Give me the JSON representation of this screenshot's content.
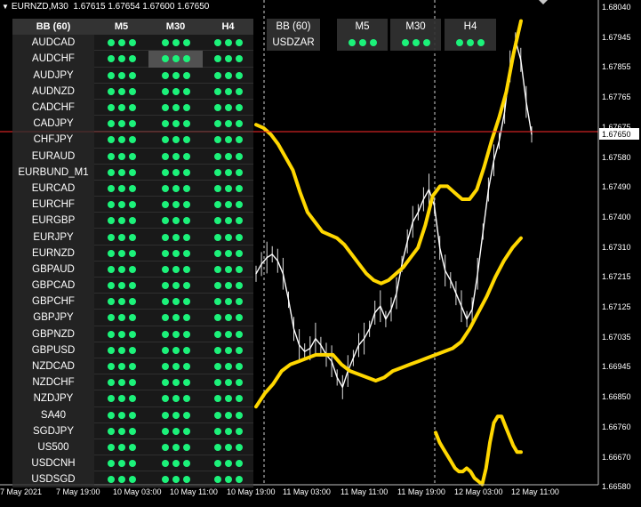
{
  "header": {
    "symbol_label": "EURNZD,M30",
    "ohlc": "1.67615 1.67654 1.67600 1.67650"
  },
  "dashboard": {
    "title": "BB (60)",
    "columns": [
      "M5",
      "M30",
      "H4"
    ],
    "rows": [
      "AUDCAD",
      "AUDCHF",
      "AUDJPY",
      "AUDNZD",
      "CADCHF",
      "CADJPY",
      "CHFJPY",
      "EURAUD",
      "EURBUND_M1",
      "EURCAD",
      "EURCHF",
      "EURGBP",
      "EURJPY",
      "EURNZD",
      "GBPAUD",
      "GBPCAD",
      "GBPCHF",
      "GBPJPY",
      "GBPNZD",
      "GBPUSD",
      "NZDCAD",
      "NZDCHF",
      "NZDJPY",
      "SA40",
      "SGDJPY",
      "US500",
      "USDCNH",
      "USDSGD"
    ],
    "signal_color": "#1cf27a",
    "highlight_cell": {
      "row": 1,
      "col": 1
    }
  },
  "dashboard2": {
    "title": "BB (60)",
    "columns": [
      "M5",
      "M30",
      "H4"
    ],
    "rows": [
      "USDZAR"
    ]
  },
  "price_axis": {
    "ticks": [
      "1.68040",
      "1.67945",
      "1.67855",
      "1.67765",
      "1.67675",
      "1.67580",
      "1.67490",
      "1.67400",
      "1.67310",
      "1.67215",
      "1.67125",
      "1.67035",
      "1.66945",
      "1.66850",
      "1.66760",
      "1.66670",
      "1.66580"
    ],
    "current_price": "1.67650"
  },
  "time_axis": {
    "labels": [
      "7 May 2021",
      "7 May 19:00",
      "10 May 03:00",
      "10 May 11:00",
      "10 May 19:00",
      "11 May 03:00",
      "11 May 11:00",
      "11 May 19:00",
      "12 May 03:00",
      "12 May 11:00"
    ]
  },
  "colors": {
    "bands": "#ffd700",
    "price_line": "#ffffff",
    "current_price_line": "#ff2a2a",
    "grid": "#cfcfcf"
  },
  "chart_data": {
    "type": "line",
    "title": "",
    "y_range": [
      1.6658,
      1.6804
    ],
    "series": [
      {
        "values": [
          1.6722,
          1.6725,
          1.6727,
          1.6728,
          1.6726,
          1.6722,
          1.6714,
          1.6705,
          1.67,
          1.6698,
          1.6699,
          1.6702,
          1.67,
          1.6697,
          1.6695,
          1.669,
          1.6687,
          1.6692,
          1.6696,
          1.67,
          1.6702,
          1.6705,
          1.671,
          1.6712,
          1.6708,
          1.6711,
          1.6716,
          1.6725,
          1.6732,
          1.6738,
          1.6741,
          1.6745,
          1.6748,
          1.6743,
          1.673,
          1.6723,
          1.672,
          1.6716,
          1.6712,
          1.6708,
          1.6711,
          1.6722,
          1.6735,
          1.6748,
          1.6757,
          1.6763,
          1.6772,
          1.6786,
          1.6794,
          1.6788,
          1.6775,
          1.6765
        ]
      },
      {
        "values": [
          1.6768,
          1.6767,
          1.6765,
          1.6762,
          1.6758,
          1.6754,
          1.6747,
          1.6741,
          1.6738,
          1.6735,
          1.6734,
          1.6733,
          1.6731,
          1.6728,
          1.6725,
          1.6722,
          1.672,
          1.6719,
          1.672,
          1.6722,
          1.6724,
          1.6727,
          1.673,
          1.6737,
          1.6746,
          1.6749,
          1.6749,
          1.6747,
          1.6745,
          1.6745,
          1.6748,
          1.6755,
          1.6763,
          1.677,
          1.6778,
          1.679,
          1.68
        ]
      },
      {
        "values": [
          1.6681,
          1.6685,
          1.6688,
          1.6692,
          1.6694,
          1.6695,
          1.6696,
          1.6697,
          1.6697,
          1.6697,
          1.6694,
          1.6692,
          1.6691,
          1.669,
          1.6689,
          1.669,
          1.6692,
          1.6693,
          1.6694,
          1.6695,
          1.6696,
          1.6697,
          1.6698,
          1.6699,
          1.6701,
          1.6705,
          1.671,
          1.6715,
          1.6721,
          1.6726,
          1.673,
          1.6733
        ]
      },
      {
        "values": [
          1.6673,
          1.667,
          1.6668,
          1.6666,
          1.6664,
          1.6662,
          1.6661,
          1.6661,
          1.6662,
          1.6661,
          1.6659,
          1.6658,
          1.6657,
          1.6662,
          1.667,
          1.6676,
          1.6678,
          1.6678,
          1.6675,
          1.6672,
          1.6669,
          1.6667,
          1.6667
        ]
      }
    ]
  }
}
